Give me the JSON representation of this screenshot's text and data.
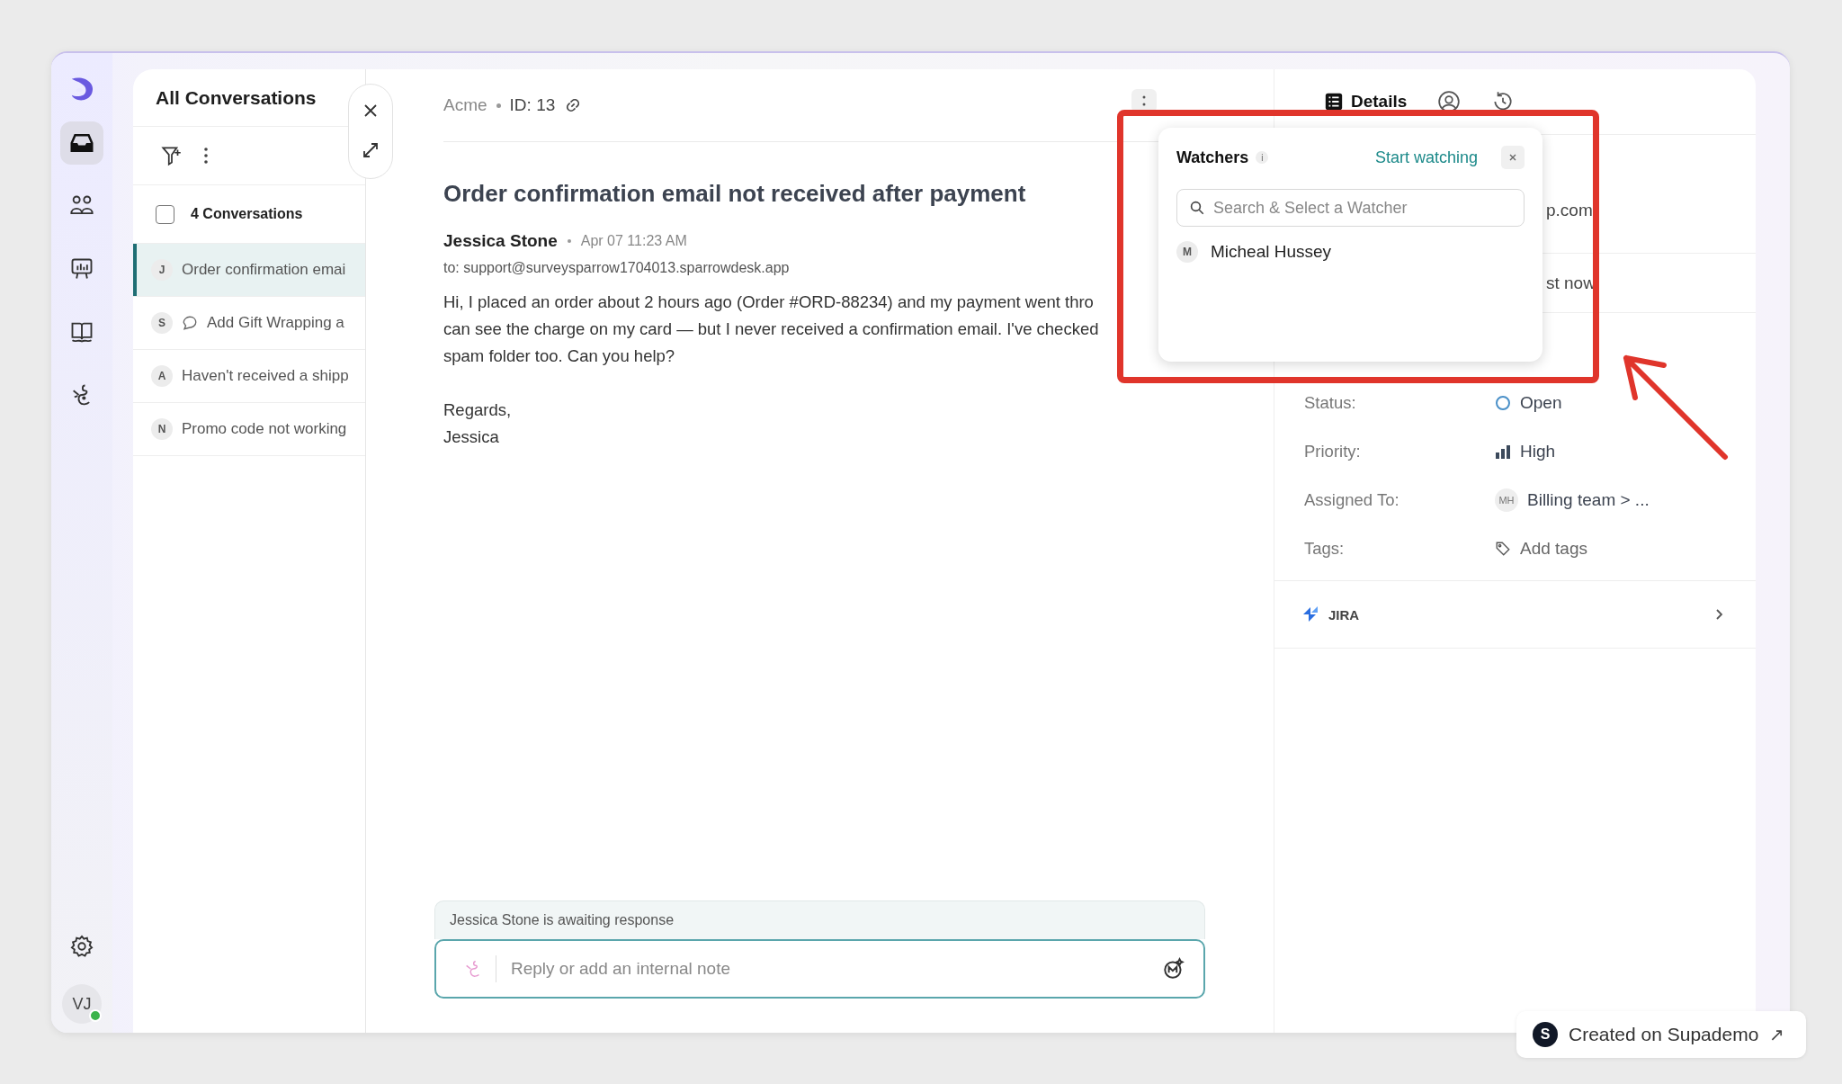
{
  "rail": {
    "items": [
      {
        "kind": "inbox",
        "selected": true
      },
      {
        "kind": "contacts",
        "selected": false
      },
      {
        "kind": "reports",
        "selected": false
      },
      {
        "kind": "knowledge",
        "selected": false
      },
      {
        "kind": "bot",
        "selected": false
      }
    ],
    "avatar": {
      "initials": "VJ",
      "online": true
    }
  },
  "conversation_list": {
    "title": "All Conversations",
    "count_label": "4 Conversations",
    "select_all_checked": false,
    "items": [
      {
        "initial": "J",
        "subject": "Order confirmation emai",
        "selected": true,
        "chat_icon": false
      },
      {
        "initial": "S",
        "subject": "Add Gift Wrapping a",
        "selected": false,
        "chat_icon": true
      },
      {
        "initial": "A",
        "subject": "Haven't received a shipp",
        "selected": false,
        "chat_icon": false
      },
      {
        "initial": "N",
        "subject": "Promo code not working",
        "selected": false,
        "chat_icon": false
      }
    ]
  },
  "ticket": {
    "company": "Acme",
    "id": "ID: 13",
    "title": "Order confirmation email not received after payment",
    "sender": "Jessica Stone",
    "time": "Apr 07 11:23 AM",
    "to": "to: support@surveysparrow1704013.sparrowdesk.app",
    "body_lines": [
      "Hi, I placed an order about 2 hours ago (Order #ORD-88234) and my payment went thro",
      "can see the charge on my card — but I never received a confirmation email. I've checked",
      "spam folder too. Can you help?"
    ],
    "signature_lines": [
      "Regards,",
      "Jessica"
    ]
  },
  "composer": {
    "status": "Jessica Stone is awaiting response",
    "placeholder": "Reply or add an internal note"
  },
  "details": {
    "tabs": [
      {
        "kind": "details",
        "label": "Details",
        "selected": true
      },
      {
        "kind": "contact",
        "selected": false
      },
      {
        "kind": "history",
        "selected": false
      }
    ],
    "partial_rows": [
      "p.com",
      "st now"
    ],
    "fields": [
      {
        "kind": "status",
        "label": "Status:",
        "value": "Open"
      },
      {
        "kind": "priority",
        "label": "Priority:",
        "value": "High"
      },
      {
        "kind": "assignee",
        "label": "Assigned To:",
        "value": "Billing team > ...",
        "initials": "MH"
      },
      {
        "kind": "tags",
        "label": "Tags:",
        "value": "Add tags"
      }
    ],
    "integrations": [
      {
        "name": "JIRA"
      }
    ]
  },
  "watchers_popup": {
    "title": "Watchers",
    "info": "i",
    "action": "Start watching",
    "search": {
      "placeholder": "Search & Select a Watcher"
    },
    "watchers": [
      {
        "initial": "M",
        "name": "Micheal Hussey"
      }
    ]
  },
  "badge": {
    "logo_letter": "S",
    "text": "Created on Supademo",
    "arrow": "↗"
  }
}
